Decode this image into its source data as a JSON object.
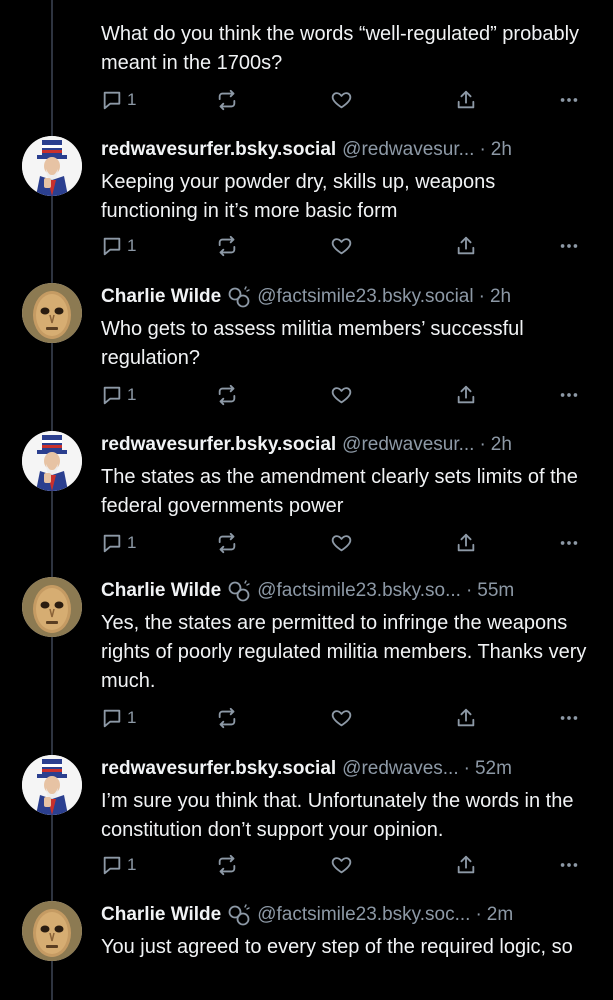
{
  "colors": {
    "background": "#000000",
    "text": "#f1f3f5",
    "muted": "#8d99a6",
    "thread_line": "#2e3440"
  },
  "top_post": {
    "text": "What do you think the words “well-regulated” probably meant in the 1700s?",
    "reply_count": "1"
  },
  "posts": [
    {
      "avatar": "uncle-sam-avatar",
      "name": "redwavesurfer.bsky.social",
      "handle": "@redwavesur...",
      "separator": "·",
      "time": "2h",
      "text": "Keeping your powder dry, skills up, weapons functioning in it’s more basic form",
      "reply_count": "1"
    },
    {
      "avatar": "mask-avatar",
      "name": "Charlie Wilde",
      "verified_icon": "link-icon",
      "handle": "@factsimile23.bsky.social",
      "separator": "·",
      "time": "2h",
      "text": "Who gets to assess militia members’ successful regulation?",
      "reply_count": "1"
    },
    {
      "avatar": "uncle-sam-avatar",
      "name": "redwavesurfer.bsky.social",
      "handle": "@redwavesur...",
      "separator": "·",
      "time": "2h",
      "text": "The states as the amendment clearly sets limits of the federal governments power",
      "reply_count": "1"
    },
    {
      "avatar": "mask-avatar",
      "name": "Charlie Wilde",
      "verified_icon": "link-icon",
      "handle": "@factsimile23.bsky.so...",
      "separator": "·",
      "time": "55m",
      "text": "Yes, the states are permitted to infringe the weapons rights of poorly regulated militia members. Thanks very much.",
      "reply_count": "1"
    },
    {
      "avatar": "uncle-sam-avatar",
      "name": "redwavesurfer.bsky.social",
      "handle": "@redwaves...",
      "separator": "·",
      "time": "52m",
      "text": "I’m sure you think that.  Unfortunately the words in the constitution don’t support your opinion.",
      "reply_count": "1"
    },
    {
      "avatar": "mask-avatar",
      "name": "Charlie Wilde",
      "verified_icon": "link-icon",
      "handle": "@factsimile23.bsky.soc...",
      "separator": "·",
      "time": "2m",
      "text": "You just agreed to every step of the required logic, so"
    }
  ]
}
